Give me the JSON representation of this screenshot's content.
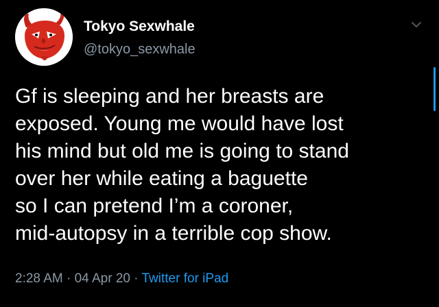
{
  "author": {
    "display_name": "Tokyo Sexwhale",
    "handle": "@tokyo_sexwhale",
    "avatar_icon": "red-devil-mask-icon"
  },
  "tweet": {
    "lines": [
      "Gf is sleeping and her breasts are",
      "exposed. Young me would have lost",
      "his mind but old me is going to stand",
      "over her while eating a baguette",
      "so I can pretend I’m a coroner,",
      "mid-autopsy in a terrible cop show."
    ],
    "time": "2:28 AM",
    "date": "04 Apr 20",
    "source": "Twitter for iPad",
    "separator": " · "
  },
  "menu_icon": "chevron-down-icon",
  "colors": {
    "background": "#000000",
    "text": "#ffffff",
    "secondary": "#8b98a5",
    "link": "#1d9bf0",
    "avatar_red": "#d62a1e"
  }
}
